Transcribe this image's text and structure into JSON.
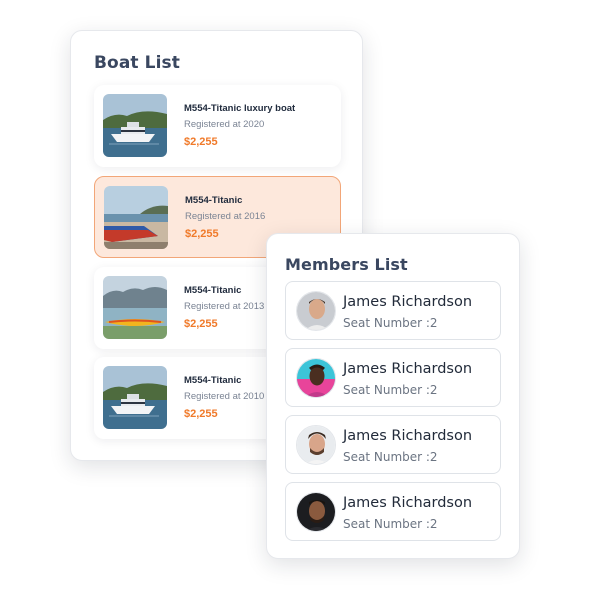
{
  "boat_list": {
    "title": "Boat List",
    "items": [
      {
        "name": "M554-Titanic luxury boat",
        "registered": "Registered at 2020",
        "price": "$2,255",
        "selected": false,
        "image": "yacht-photo"
      },
      {
        "name": "M554-Titanic",
        "registered": "Registered at 2016",
        "price": "$2,255",
        "selected": true,
        "image": "beached-boat-photo"
      },
      {
        "name": "M554-Titanic",
        "registered": "Registered at 2013",
        "price": "$2,255",
        "selected": false,
        "image": "kayak-photo"
      },
      {
        "name": "M554-Titanic",
        "registered": "Registered at 2010",
        "price": "$2,255",
        "selected": false,
        "image": "yacht-photo"
      }
    ]
  },
  "members_list": {
    "title": "Members List",
    "items": [
      {
        "name": "James Richardson",
        "seat": "Seat Number :2",
        "avatar": "avatar-photo"
      },
      {
        "name": "James Richardson",
        "seat": "Seat Number :2",
        "avatar": "avatar-photo"
      },
      {
        "name": "James Richardson",
        "seat": "Seat Number :2",
        "avatar": "avatar-photo"
      },
      {
        "name": "James Richardson",
        "seat": "Seat Number :2",
        "avatar": "avatar-photo"
      }
    ]
  },
  "colors": {
    "price": "#f07a2a",
    "selected_bg": "#fde8dc",
    "selected_border": "#f2a678",
    "title": "#3a4760"
  }
}
